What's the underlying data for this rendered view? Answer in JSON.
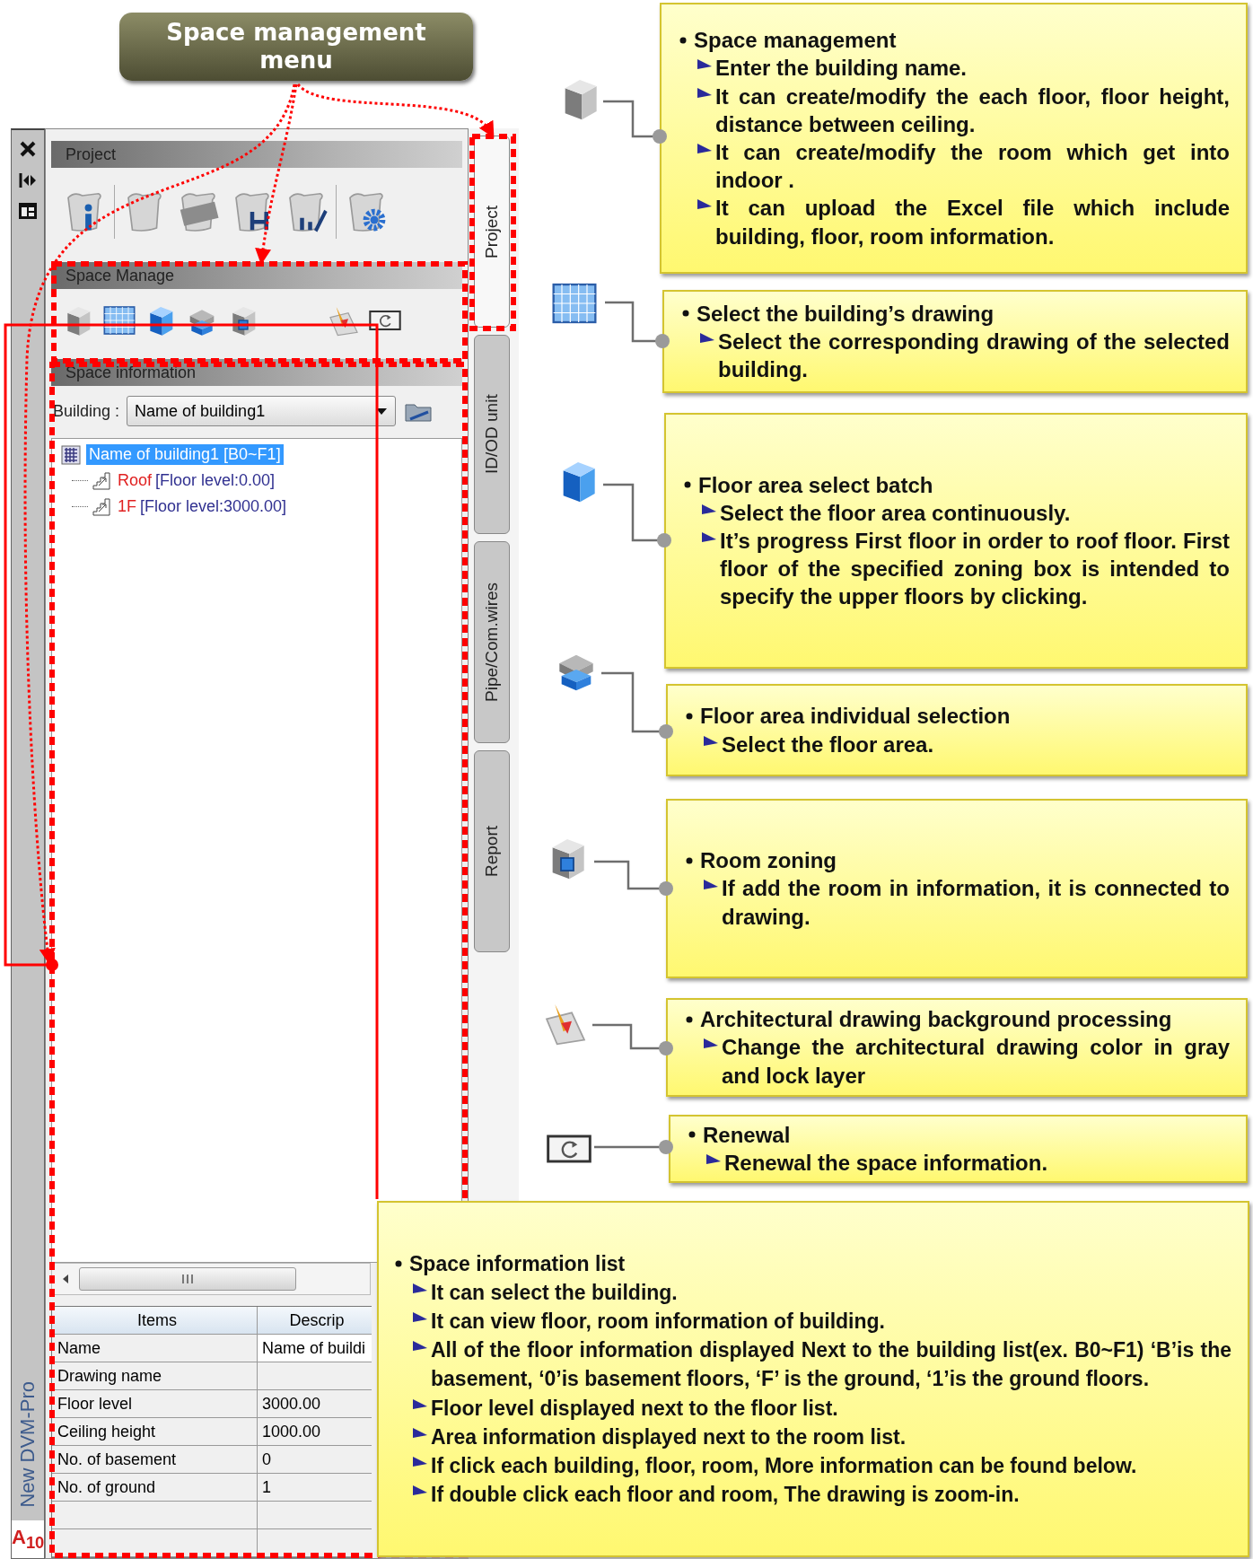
{
  "menu_badge": {
    "label": "Space management menu"
  },
  "side_strip": {
    "label": "New DVM-Pro",
    "logo": "A$_{10}$"
  },
  "panel": {
    "sections": [
      {
        "title": "Project",
        "tools": [
          {
            "kind": "info"
          },
          {
            "kind": "scroll"
          },
          {
            "kind": "open"
          },
          {
            "kind": "save"
          },
          {
            "kind": "save-as"
          },
          {
            "kind": "settings"
          }
        ]
      },
      {
        "title": "Space Manage",
        "tools": [
          {
            "kind": "building"
          },
          {
            "kind": "grid"
          },
          {
            "kind": "floors"
          },
          {
            "kind": "floor"
          },
          {
            "kind": "room"
          },
          {
            "kind": "background"
          },
          {
            "kind": "renewal"
          }
        ]
      },
      {
        "title": "Space information"
      }
    ],
    "building": {
      "label": "Building :",
      "value": "Name of building1"
    },
    "tree": [
      {
        "label": "Name of building1 [B0~F1]",
        "selected": true,
        "children": [
          {
            "name": "Roof",
            "info": "[Floor level:0.00]",
            "selected": false
          },
          {
            "name": "1F",
            "info": "[Floor level:3000.00]",
            "selected": false
          }
        ]
      }
    ],
    "table": {
      "columns": [
        "Items",
        "Descrip"
      ],
      "rows": [
        {
          "item": "Name",
          "value": "Name of buildi"
        },
        {
          "item": "Drawing name"
        },
        {
          "item": "Floor level",
          "value": "3000.00"
        },
        {
          "item": "Ceiling height",
          "value": "1000.00"
        },
        {
          "item": "No. of basement",
          "value": "0"
        },
        {
          "item": "No. of ground",
          "value": "1"
        }
      ]
    },
    "side_tabs": [
      {
        "label": "Project",
        "selected": true
      },
      {
        "label": "ID/OD unit",
        "selected": false
      },
      {
        "label": "Pipe/Com.wires",
        "selected": false
      },
      {
        "label": "Report",
        "selected": false
      }
    ]
  },
  "callouts": [
    {
      "kind": "building",
      "title": "Space management",
      "items": [
        "Enter the building name.",
        "It can create/modify the each floor, floor height, distance between ceiling.",
        "It can create/modify the room which get into indoor .",
        "It can upload the Excel file which include building, floor, room information."
      ]
    },
    {
      "kind": "grid",
      "title": "Select the building’s drawing",
      "items": [
        "Select the corresponding drawing of the selected building."
      ]
    },
    {
      "kind": "floors",
      "title": "Floor area select batch",
      "items": [
        "Select the floor area continuously.",
        "It’s progress First floor in order to roof floor. First floor of the specified zoning box is intended to specify the upper floors by clicking."
      ]
    },
    {
      "kind": "floor",
      "title": "Floor area individual selection",
      "items": [
        "Select the floor area."
      ]
    },
    {
      "kind": "room",
      "title": "Room zoning",
      "items": [
        "If add the room in information, it is connected to drawing."
      ]
    },
    {
      "kind": "background",
      "title": "Architectural drawing background processing",
      "items": [
        "Change the architectural drawing color in gray and lock layer"
      ]
    },
    {
      "kind": "renewal",
      "title": "Renewal",
      "items": [
        "Renewal the space information."
      ]
    },
    {
      "kind": "list",
      "title": "Space information list",
      "items": [
        "It can select the building.",
        "It can view floor, room information of building.",
        "All of the floor information displayed Next to the building list(ex. B0~F1) ‘B’is the basement, ‘0’is basement floors, ‘F’ is the ground, ‘1’is the ground floors.",
        "Floor level displayed next to the floor list.",
        "Area information displayed next to the room list.",
        "If click each building, floor, room, More information can be found below.",
        "If double click each floor and room, The drawing is zoom-in."
      ]
    }
  ]
}
